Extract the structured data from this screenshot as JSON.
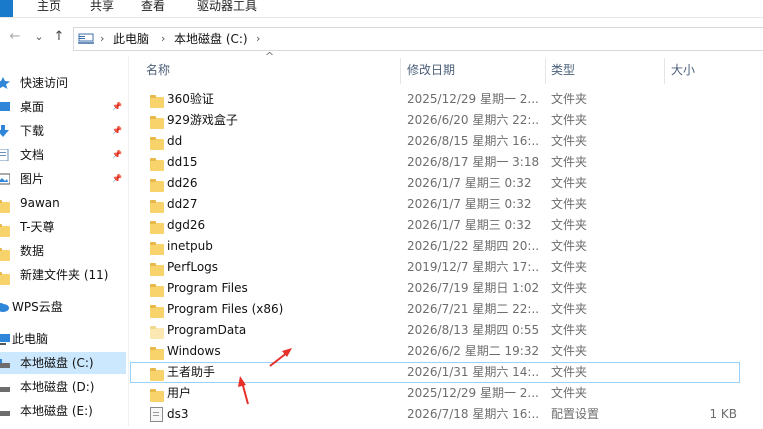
{
  "ribbon": {
    "tabs": [
      "主页",
      "共享",
      "查看",
      "驱动器工具"
    ]
  },
  "nav": {
    "back": "←",
    "forward": "→",
    "recent": "⌄",
    "up": "↑",
    "breadcrumb": [
      "此电脑",
      "本地磁盘 (C:)"
    ],
    "breadcrumb_sep": "›"
  },
  "sidebar": {
    "items": [
      {
        "label": "快速访问",
        "icon": "star-icon",
        "pinned": false
      },
      {
        "label": "桌面",
        "icon": "desktop-icon",
        "pinned": true
      },
      {
        "label": "下载",
        "icon": "download-icon",
        "pinned": true
      },
      {
        "label": "文档",
        "icon": "document-icon",
        "pinned": true
      },
      {
        "label": "图片",
        "icon": "picture-icon",
        "pinned": true
      },
      {
        "label": "9awan",
        "icon": "folder-icon",
        "pinned": false
      },
      {
        "label": "T-天尊",
        "icon": "folder-icon",
        "pinned": false
      },
      {
        "label": "数据",
        "icon": "folder-icon",
        "pinned": false
      },
      {
        "label": "新建文件夹 (11)",
        "icon": "folder-icon",
        "pinned": false
      },
      {
        "label": "WPS云盘",
        "icon": "cloud-icon",
        "pinned": false
      },
      {
        "label": "此电脑",
        "icon": "computer-icon",
        "pinned": false
      },
      {
        "label": "本地磁盘 (C:)",
        "icon": "drive-icon",
        "pinned": false,
        "selected": true
      },
      {
        "label": "本地磁盘 (D:)",
        "icon": "drive-icon",
        "pinned": false
      },
      {
        "label": "本地磁盘 (E:)",
        "icon": "drive-icon",
        "pinned": false
      }
    ],
    "pin_glyph": "📌"
  },
  "columns": {
    "name": "名称",
    "date": "修改日期",
    "type": "类型",
    "size": "大小",
    "sort_indicator": "^"
  },
  "files": [
    {
      "name": "360验证",
      "date": "2025/12/29 星期一 2...",
      "type": "文件夹",
      "size": "",
      "icon": "folder-icon"
    },
    {
      "name": "929游戏盒子",
      "date": "2026/6/20 星期六 22:...",
      "type": "文件夹",
      "size": "",
      "icon": "folder-icon"
    },
    {
      "name": "dd",
      "date": "2026/8/15 星期六 16:...",
      "type": "文件夹",
      "size": "",
      "icon": "folder-icon"
    },
    {
      "name": "dd15",
      "date": "2026/8/17 星期一 3:18",
      "type": "文件夹",
      "size": "",
      "icon": "folder-icon"
    },
    {
      "name": "dd26",
      "date": "2026/1/7 星期三 0:32",
      "type": "文件夹",
      "size": "",
      "icon": "folder-icon"
    },
    {
      "name": "dd27",
      "date": "2026/1/7 星期三 0:32",
      "type": "文件夹",
      "size": "",
      "icon": "folder-icon"
    },
    {
      "name": "dgd26",
      "date": "2026/1/7 星期三 0:32",
      "type": "文件夹",
      "size": "",
      "icon": "folder-icon"
    },
    {
      "name": "inetpub",
      "date": "2026/1/22 星期四 20:...",
      "type": "文件夹",
      "size": "",
      "icon": "folder-icon"
    },
    {
      "name": "PerfLogs",
      "date": "2019/12/7 星期六 17:...",
      "type": "文件夹",
      "size": "",
      "icon": "folder-icon"
    },
    {
      "name": "Program Files",
      "date": "2026/7/19 星期日 1:02",
      "type": "文件夹",
      "size": "",
      "icon": "folder-icon"
    },
    {
      "name": "Program Files (x86)",
      "date": "2026/7/21 星期二 22:...",
      "type": "文件夹",
      "size": "",
      "icon": "folder-icon"
    },
    {
      "name": "ProgramData",
      "date": "2026/8/13 星期四 0:55",
      "type": "文件夹",
      "size": "",
      "icon": "folder-light-icon"
    },
    {
      "name": "Windows",
      "date": "2026/6/2 星期二 19:32",
      "type": "文件夹",
      "size": "",
      "icon": "folder-icon"
    },
    {
      "name": "王者助手",
      "date": "2026/1/31 星期六 14:...",
      "type": "文件夹",
      "size": "",
      "icon": "folder-icon",
      "focused": true
    },
    {
      "name": "用户",
      "date": "2025/12/29 星期一 2...",
      "type": "文件夹",
      "size": "",
      "icon": "folder-icon"
    },
    {
      "name": "ds3",
      "date": "2026/7/18 星期六 16:...",
      "type": "配置设置",
      "size": "1 KB",
      "icon": "config-file-icon"
    }
  ],
  "colors": {
    "selected_bg": "#cce8ff",
    "focus_border": "#99d1ff",
    "header_text": "#4c607a",
    "annotation_red": "#e8302a"
  }
}
